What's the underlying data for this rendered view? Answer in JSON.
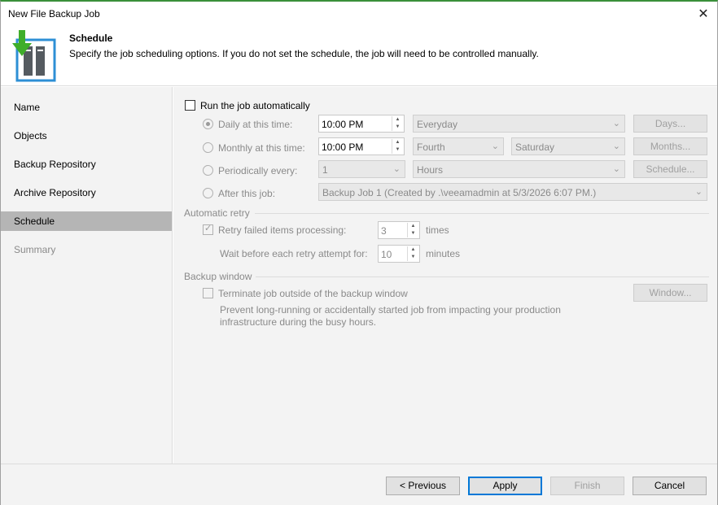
{
  "window": {
    "title": "New File Backup Job",
    "close_glyph": "✕"
  },
  "header": {
    "title": "Schedule",
    "subtitle": "Specify the job scheduling options. If you do not set the schedule, the job will need to be controlled manually.",
    "logo_icon": "backup-job-icon"
  },
  "sidebar": {
    "items": [
      {
        "label": "Name"
      },
      {
        "label": "Objects"
      },
      {
        "label": "Backup Repository"
      },
      {
        "label": "Archive Repository"
      },
      {
        "label": "Schedule"
      },
      {
        "label": "Summary"
      }
    ]
  },
  "schedule": {
    "run_auto_label": "Run the job automatically",
    "run_auto_checked": false,
    "daily": {
      "label": "Daily at this time:",
      "time": "10:00 PM",
      "days_option": "Everyday",
      "days_button": "Days..."
    },
    "monthly": {
      "label": "Monthly at this time:",
      "time": "10:00 PM",
      "week": "Fourth",
      "day": "Saturday",
      "months_button": "Months..."
    },
    "periodic": {
      "label": "Periodically every:",
      "value": "1",
      "unit": "Hours",
      "schedule_button": "Schedule..."
    },
    "after": {
      "label": "After this job:",
      "job": "Backup Job 1 (Created by .\\veeamadmin at 5/3/2026 6:07 PM.)"
    }
  },
  "retry": {
    "group_label": "Automatic retry",
    "retry_label": "Retry failed items processing:",
    "retry_count": "3",
    "retry_unit": "times",
    "wait_label": "Wait before each retry attempt for:",
    "wait_value": "10",
    "wait_unit": "minutes"
  },
  "backup_window": {
    "group_label": "Backup window",
    "terminate_label": "Terminate job outside of the backup window",
    "description_line1": "Prevent long-running or accidentally started job from impacting your production",
    "description_line2": "infrastructure during the busy hours.",
    "window_button": "Window..."
  },
  "footer": {
    "previous": "< Previous",
    "apply": "Apply",
    "finish": "Finish",
    "cancel": "Cancel"
  },
  "colors": {
    "accent": "#0078d7",
    "green_arrow": "#3fae2a",
    "logo_blue": "#2d8fd5",
    "selected_item": "#b5b5b5"
  }
}
